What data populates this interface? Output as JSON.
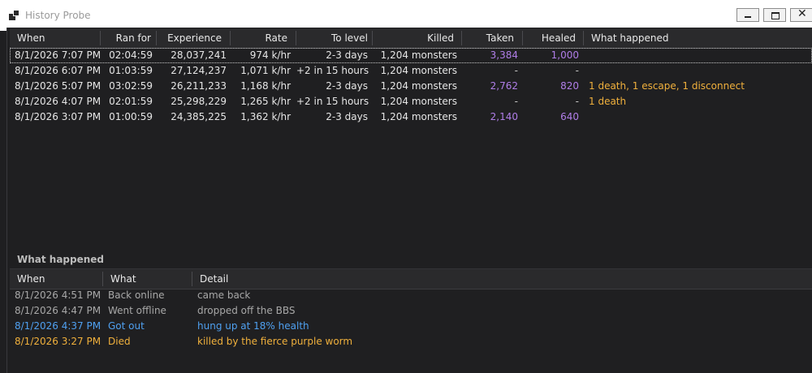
{
  "window": {
    "title": "History Probe"
  },
  "sessions": {
    "columns": {
      "when": "When",
      "ran_for": "Ran for",
      "experience": "Experience",
      "rate": "Rate",
      "to_level": "To level",
      "killed": "Killed",
      "taken": "Taken",
      "healed": "Healed",
      "what_happened": "What happened"
    },
    "rows": [
      {
        "when": "8/1/2026 7:07 PM",
        "ran_for": "02:04:59",
        "experience": "28,037,241",
        "rate": "974 k/hr",
        "to_level": "2-3 days",
        "killed": "1,204 monsters",
        "taken": "3,384",
        "healed": "1,000",
        "what_happened": ""
      },
      {
        "when": "8/1/2026 6:07 PM",
        "ran_for": "01:03:59",
        "experience": "27,124,237",
        "rate": "1,071 k/hr",
        "to_level": "+2 in 15 hours",
        "killed": "1,204 monsters",
        "taken": "-",
        "healed": "-",
        "what_happened": ""
      },
      {
        "when": "8/1/2026 5:07 PM",
        "ran_for": "03:02:59",
        "experience": "26,211,233",
        "rate": "1,168 k/hr",
        "to_level": "2-3 days",
        "killed": "1,204 monsters",
        "taken": "2,762",
        "healed": "820",
        "what_happened": "1 death, 1 escape, 1 disconnect"
      },
      {
        "when": "8/1/2026 4:07 PM",
        "ran_for": "02:01:59",
        "experience": "25,298,229",
        "rate": "1,265 k/hr",
        "to_level": "+2 in 15 hours",
        "killed": "1,204 monsters",
        "taken": "-",
        "healed": "-",
        "what_happened": "1 death"
      },
      {
        "when": "8/1/2026 3:07 PM",
        "ran_for": "01:00:59",
        "experience": "24,385,225",
        "rate": "1,362 k/hr",
        "to_level": "2-3 days",
        "killed": "1,204 monsters",
        "taken": "2,140",
        "healed": "640",
        "what_happened": ""
      }
    ]
  },
  "events": {
    "section_title": "What happened",
    "columns": {
      "when": "When",
      "what": "What",
      "detail": "Detail"
    },
    "rows": [
      {
        "when": "8/1/2026 4:51 PM",
        "what": "Back online",
        "detail": "came back"
      },
      {
        "when": "8/1/2026 4:47 PM",
        "what": "Went offline",
        "detail": "dropped off the BBS"
      },
      {
        "when": "8/1/2026 4:37 PM",
        "what": "Got out",
        "detail": "hung up at 18% health"
      },
      {
        "when": "8/1/2026 3:27 PM",
        "what": "Died",
        "detail": "killed by the fierce purple worm"
      }
    ]
  },
  "colors": {
    "taken_healed": "#b07ee8",
    "death": "#f0b03c",
    "escape": "#4fa0f0",
    "status": "#a8a8a8"
  }
}
